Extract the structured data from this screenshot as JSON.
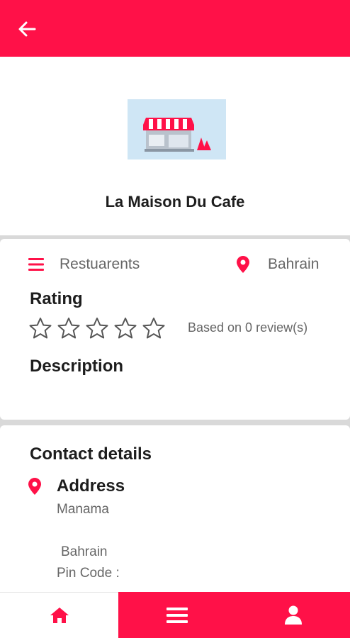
{
  "colors": {
    "accent": "#ff1148",
    "muted_text": "#666666"
  },
  "appbar": {
    "back_icon": "arrow-left-icon"
  },
  "header": {
    "shop_name": "La Maison Du Cafe",
    "image_icon": "storefront-icon"
  },
  "info": {
    "category": "Restuarents",
    "location": "Bahrain",
    "rating_title": "Rating",
    "rating_value": 0,
    "rating_max": 5,
    "reviews_text": "Based on 0 review(s)",
    "description_title": "Description"
  },
  "contact": {
    "title": "Contact details",
    "address_title": "Address",
    "city": "Manama",
    "country": "Bahrain",
    "pin_code": "Pin Code :"
  },
  "nav": {
    "home_icon": "home-icon",
    "menu_icon": "menu-icon",
    "profile_icon": "user-icon"
  }
}
